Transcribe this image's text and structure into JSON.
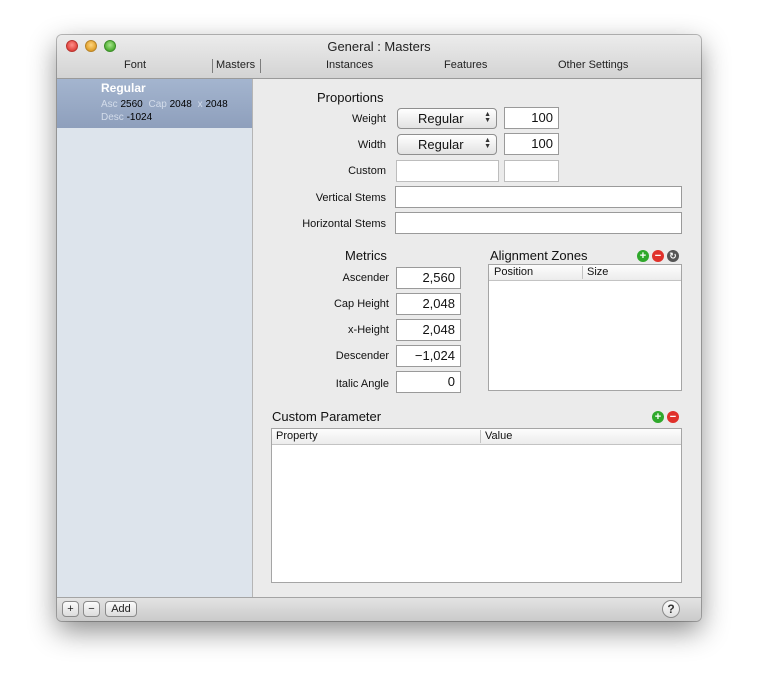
{
  "window": {
    "title": "General : Masters",
    "tabs": [
      "Font",
      "Masters",
      "Instances",
      "Features",
      "Other Settings"
    ]
  },
  "sidebar": {
    "masters": [
      {
        "name": "Regular",
        "asc_label": "Asc",
        "asc": "2560",
        "cap_label": "Cap",
        "cap": "2048",
        "x_label": "x",
        "x": "2048",
        "desc_label": "Desc",
        "desc": "-1024"
      }
    ],
    "add_icon": "+",
    "remove_icon": "−",
    "add_label": "Add"
  },
  "proportions": {
    "title": "Proportions",
    "weight_label": "Weight",
    "weight_value": "Regular",
    "weight_number": "100",
    "width_label": "Width",
    "width_value": "Regular",
    "width_number": "100",
    "custom_label": "Custom",
    "custom_value": "",
    "custom_number": "",
    "vertical_stems_label": "Vertical Stems",
    "vertical_stems_value": "",
    "horizontal_stems_label": "Horizontal Stems",
    "horizontal_stems_value": ""
  },
  "metrics": {
    "title": "Metrics",
    "ascender_label": "Ascender",
    "ascender": "2,560",
    "cap_height_label": "Cap Height",
    "cap_height": "2,048",
    "x_height_label": "x-Height",
    "x_height": "2,048",
    "descender_label": "Descender",
    "descender": "−1,024",
    "italic_angle_label": "Italic Angle",
    "italic_angle": "0"
  },
  "alignment_zones": {
    "title": "Alignment Zones",
    "columns": [
      "Position",
      "Size"
    ],
    "rows": []
  },
  "custom_parameter": {
    "title": "Custom Parameter",
    "columns": [
      "Property",
      "Value"
    ],
    "rows": []
  },
  "icons": {
    "plus": "+",
    "minus": "−",
    "refresh": "↻",
    "help": "?"
  }
}
